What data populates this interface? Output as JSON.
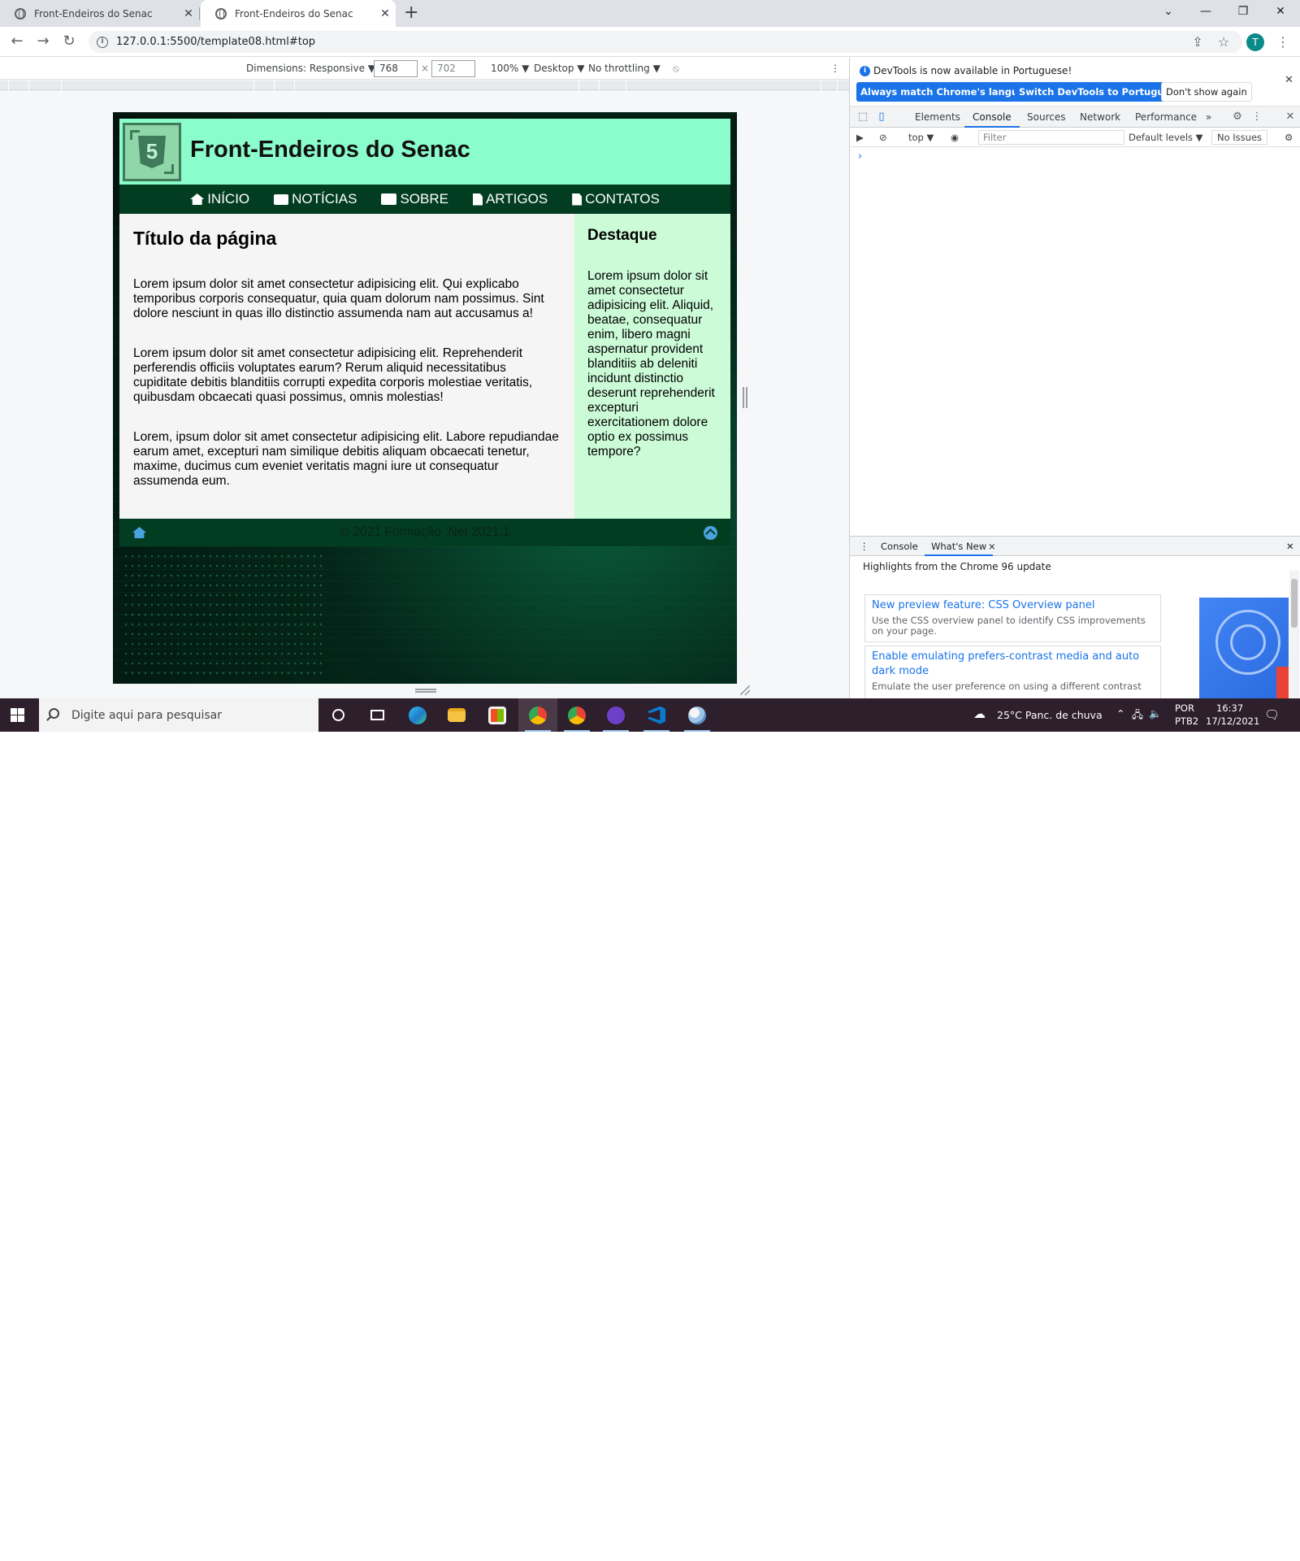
{
  "browser": {
    "tabs": [
      {
        "title": "Front-Endeiros do Senac",
        "active": false
      },
      {
        "title": "Front-Endeiros do Senac",
        "active": true
      }
    ],
    "url": "127.0.0.1:5500/template08.html#top",
    "profile_initial": "T"
  },
  "device_toolbar": {
    "dimensions_label": "Dimensions: Responsive ▼",
    "width": "768",
    "height": "702",
    "separator": "×",
    "zoom": "100% ▼",
    "device_type": "Desktop ▼",
    "throttling": "No throttling ▼"
  },
  "site": {
    "title": "Front-Endeiros do Senac",
    "logo_digit": "5",
    "nav": [
      {
        "label": "INÍCIO",
        "icon": "home-icon"
      },
      {
        "label": "NOTÍCIAS",
        "icon": "newspaper-icon"
      },
      {
        "label": "SOBRE",
        "icon": "id-card-icon"
      },
      {
        "label": "ARTIGOS",
        "icon": "file-icon"
      },
      {
        "label": "CONTATOS",
        "icon": "contact-file-icon"
      }
    ],
    "main": {
      "heading": "Título da página",
      "paragraphs": [
        "Lorem ipsum dolor sit amet consectetur adipisicing elit. Qui explicabo temporibus corporis consequatur, quia quam dolorum nam possimus. Sint dolore nesciunt in quas illo distinctio assumenda nam aut accusamus a!",
        "Lorem ipsum dolor sit amet consectetur adipisicing elit. Reprehenderit perferendis officiis voluptates earum? Rerum aliquid necessitatibus cupiditate debitis blanditiis corrupti expedita corporis molestiae veritatis, quibusdam obcaecati quasi possimus, omnis molestias!",
        "Lorem, ipsum dolor sit amet consectetur adipisicing elit. Labore repudiandae earum amet, excepturi nam similique debitis aliquam obcaecati tenetur, maxime, ducimus cum eveniet veritatis magni iure ut consequatur assumenda eum."
      ]
    },
    "aside": {
      "heading": "Destaque",
      "text": "Lorem ipsum dolor sit amet consectetur adipisicing elit. Aliquid, beatae, consequatur enim, libero magni aspernatur provident blanditiis ab deleniti incidunt distinctio deserunt reprehenderit excepturi exercitationem dolore optio ex possimus tempore?"
    },
    "footer": {
      "text": "© 2021 Formação .Net 2021.1"
    },
    "colors": {
      "header_bg": "#8bfccb",
      "nav_bg": "#023d22",
      "main_bg": "#f5f5f5",
      "aside_bg": "#ccfbd8",
      "footer_icon": "#4aa3df"
    }
  },
  "devtools": {
    "info_message": "DevTools is now available in Portuguese!",
    "btn_match": "Always match Chrome's language",
    "btn_switch": "Switch DevTools to Portuguese",
    "btn_dont_show": "Don't show again",
    "tabs": [
      "Elements",
      "Console",
      "Sources",
      "Network",
      "Performance"
    ],
    "selected_tab": "Console",
    "more_tabs": "»",
    "console_context": "top ▼",
    "filter_placeholder": "Filter",
    "levels": "Default levels ▼",
    "issues": "No Issues",
    "prompt": "›",
    "drawer": {
      "tabs": [
        "Console",
        "What's New"
      ],
      "tab_close": "×",
      "highlights": "Highlights from the Chrome 96 update",
      "cards": [
        {
          "title": "New preview feature: CSS Overview panel",
          "desc": "Use the CSS overview panel to identify CSS improvements on your page."
        },
        {
          "title": "Enable emulating prefers-contrast media and auto dark mode",
          "desc": "Emulate the user preference on using a different contrast"
        }
      ]
    }
  },
  "taskbar": {
    "search_placeholder": "Digite aqui para pesquisar",
    "weather": "25°C  Panc. de chuva",
    "lang_top": "POR",
    "lang_bottom": "PTB2",
    "time": "16:37",
    "date": "17/12/2021"
  }
}
